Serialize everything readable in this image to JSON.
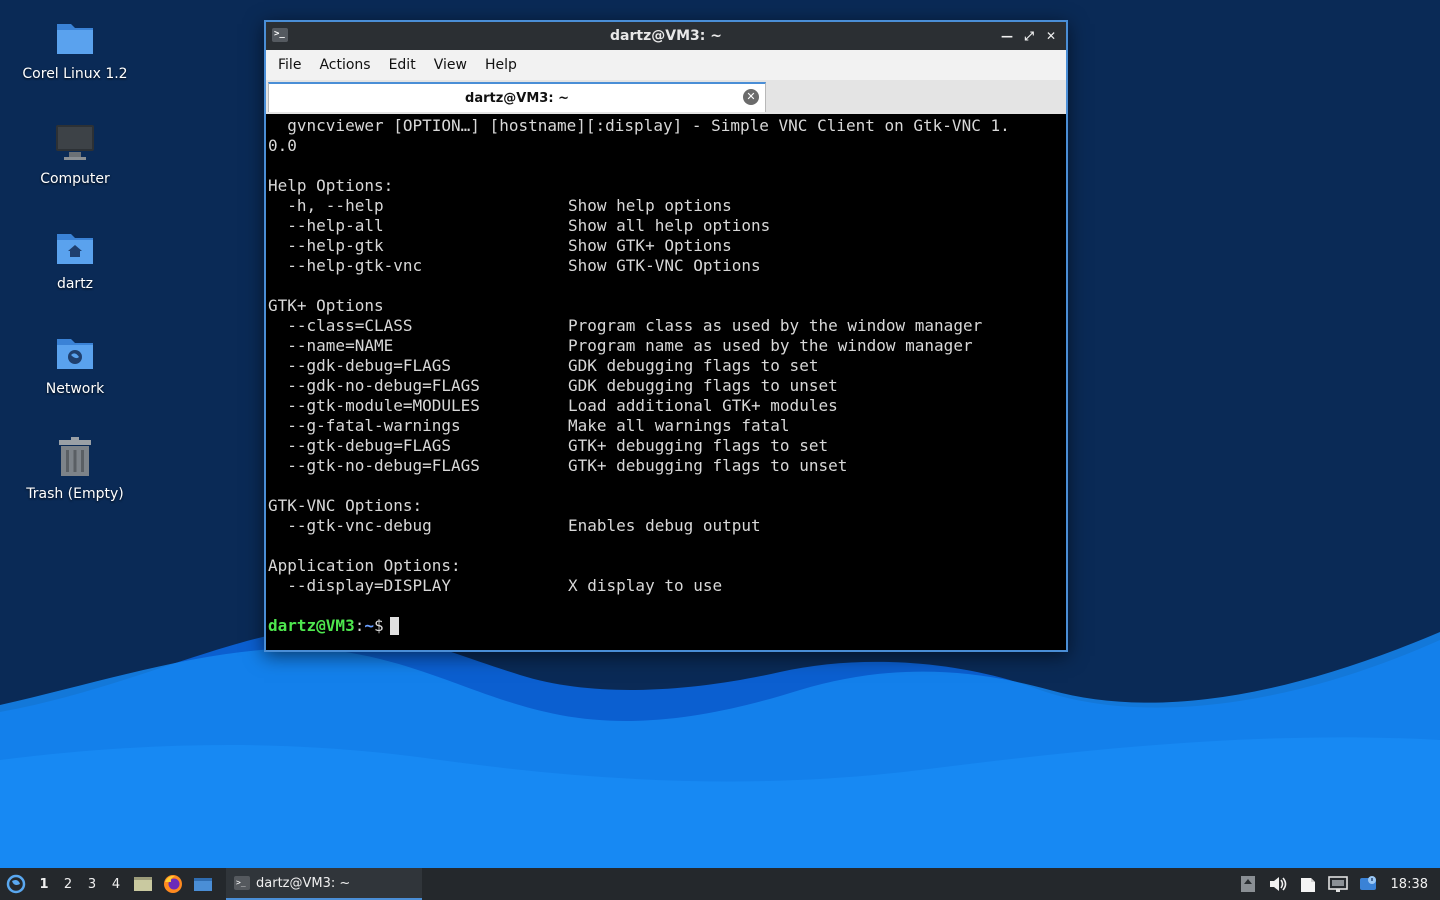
{
  "desktop": {
    "icons": [
      {
        "label": "Corel Linux 1.2",
        "icon": "folder-icon"
      },
      {
        "label": "Computer",
        "icon": "computer-icon"
      },
      {
        "label": "dartz",
        "icon": "home-folder-icon"
      },
      {
        "label": "Network",
        "icon": "network-folder-icon"
      },
      {
        "label": "Trash (Empty)",
        "icon": "trash-icon"
      }
    ]
  },
  "window": {
    "title": "dartz@VM3: ~",
    "menu": [
      "File",
      "Actions",
      "Edit",
      "View",
      "Help"
    ],
    "tab_label": "dartz@VM3: ~"
  },
  "terminal": {
    "lines": [
      {
        "text": "  gvncviewer [OPTION…] [hostname][:display] - Simple VNC Client on Gtk-VNC 1."
      },
      {
        "text": "0.0"
      },
      {
        "text": ""
      },
      {
        "text": "Help Options:"
      },
      {
        "opt": "  -h, --help",
        "desc": "Show help options"
      },
      {
        "opt": "  --help-all",
        "desc": "Show all help options"
      },
      {
        "opt": "  --help-gtk",
        "desc": "Show GTK+ Options"
      },
      {
        "opt": "  --help-gtk-vnc",
        "desc": "Show GTK-VNC Options"
      },
      {
        "text": ""
      },
      {
        "text": "GTK+ Options"
      },
      {
        "opt": "  --class=CLASS",
        "desc": "Program class as used by the window manager"
      },
      {
        "opt": "  --name=NAME",
        "desc": "Program name as used by the window manager"
      },
      {
        "opt": "  --gdk-debug=FLAGS",
        "desc": "GDK debugging flags to set"
      },
      {
        "opt": "  --gdk-no-debug=FLAGS",
        "desc": "GDK debugging flags to unset"
      },
      {
        "opt": "  --gtk-module=MODULES",
        "desc": "Load additional GTK+ modules"
      },
      {
        "opt": "  --g-fatal-warnings",
        "desc": "Make all warnings fatal"
      },
      {
        "opt": "  --gtk-debug=FLAGS",
        "desc": "GTK+ debugging flags to set"
      },
      {
        "opt": "  --gtk-no-debug=FLAGS",
        "desc": "GTK+ debugging flags to unset"
      },
      {
        "text": ""
      },
      {
        "text": "GTK-VNC Options:"
      },
      {
        "opt": "  --gtk-vnc-debug",
        "desc": "Enables debug output"
      },
      {
        "text": ""
      },
      {
        "text": "Application Options:"
      },
      {
        "opt": "  --display=DISPLAY",
        "desc": "X display to use"
      },
      {
        "text": ""
      }
    ],
    "prompt_user": "dartz@VM3",
    "prompt_sep": ":",
    "prompt_path": "~",
    "prompt_symbol": "$"
  },
  "taskbar": {
    "workspaces": [
      "1",
      "2",
      "3",
      "4"
    ],
    "active_workspace": "1",
    "launchers": [
      "file-manager-icon",
      "firefox-icon",
      "desktop-icon"
    ],
    "task_label": "dartz@VM3: ~",
    "clock": "18:38"
  },
  "colors": {
    "accent": "#4a8ed6",
    "prompt_user": "#4ee64e",
    "prompt_path": "#6a9fff"
  }
}
